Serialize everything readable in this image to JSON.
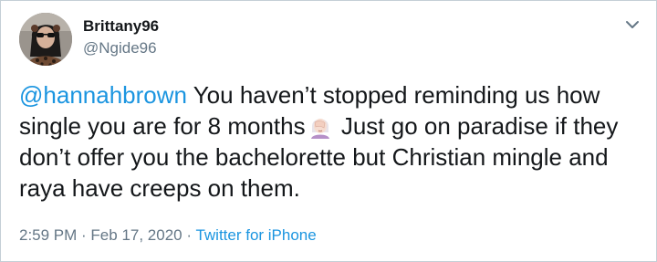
{
  "user": {
    "display_name": "Brittany96",
    "handle": "@Ngide96",
    "avatar_icon": "profile-photo"
  },
  "menu_icon": "chevron-down-icon",
  "tweet": {
    "mention": "@hannahbrown",
    "text_before_emoji": " You haven’t stopped reminding us how single you are for 8 months",
    "emoji": "woman-facepalming-emoji",
    "text_after_emoji": " Just go on paradise if they don’t offer you the bachelorette but Christian mingle and raya have creeps on them."
  },
  "meta": {
    "time": "2:59 PM",
    "separator_1": " · ",
    "date": "Feb 17, 2020",
    "separator_2": " · ",
    "source": "Twitter for iPhone"
  },
  "colors": {
    "link": "#1b95e0",
    "text": "#14171a",
    "secondary": "#657786",
    "border": "#c4cfd6"
  }
}
